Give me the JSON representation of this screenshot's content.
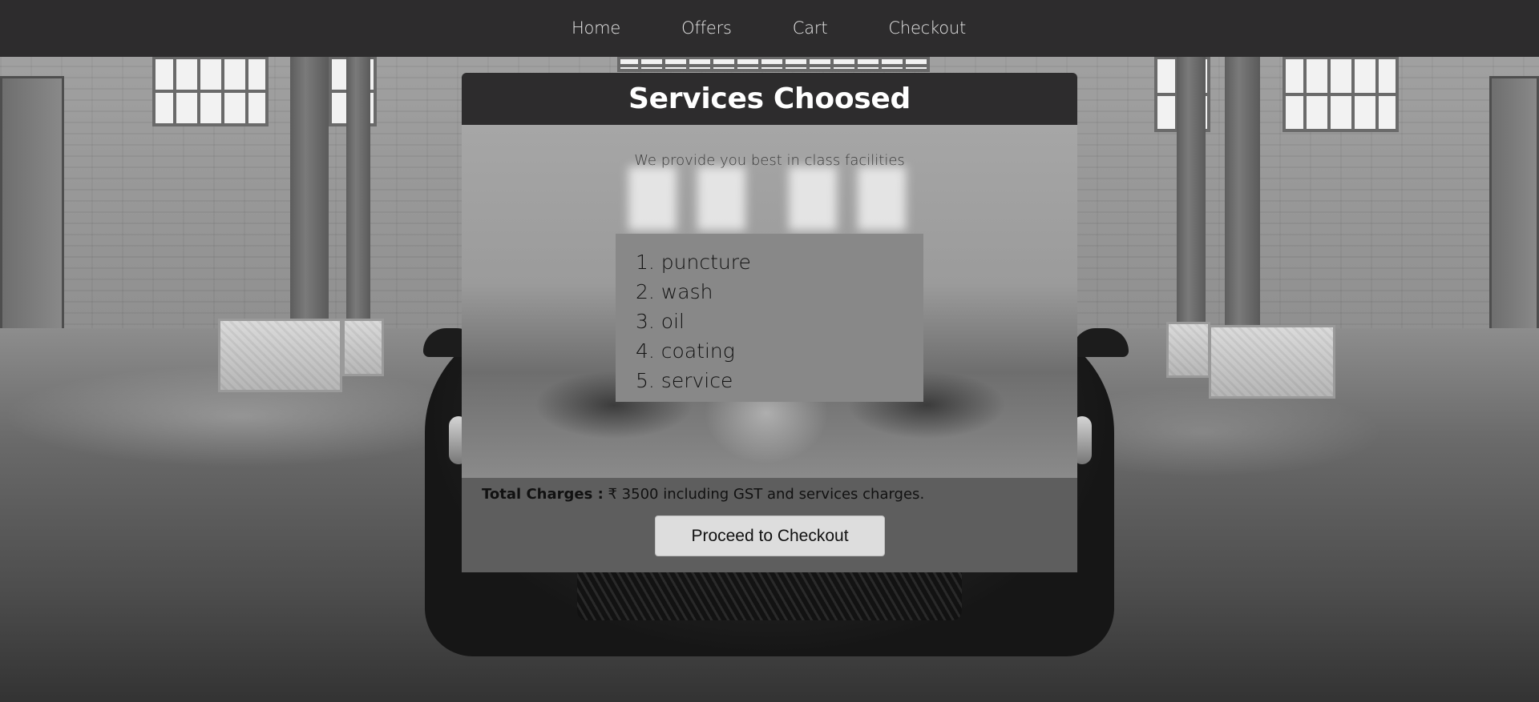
{
  "nav": {
    "items": [
      {
        "label": "Home"
      },
      {
        "label": "Offers"
      },
      {
        "label": "Cart"
      },
      {
        "label": "Checkout"
      }
    ]
  },
  "card": {
    "title": "Services Choosed",
    "tagline": "We provide you best in class facilities",
    "services": [
      "1. puncture",
      "2. wash",
      "3. oil",
      "4. coating",
      "5. service"
    ],
    "total_label": "Total Charges :",
    "total_value": " ₹ 3500 including GST and services charges.",
    "button_label": "Proceed to Checkout"
  },
  "colors": {
    "nav_bg": "#2d2c2d",
    "header_bg": "#2d2c2d",
    "list_bg": "#888888",
    "footer_bg": "#5e5e5e",
    "button_bg": "#dddddd"
  }
}
